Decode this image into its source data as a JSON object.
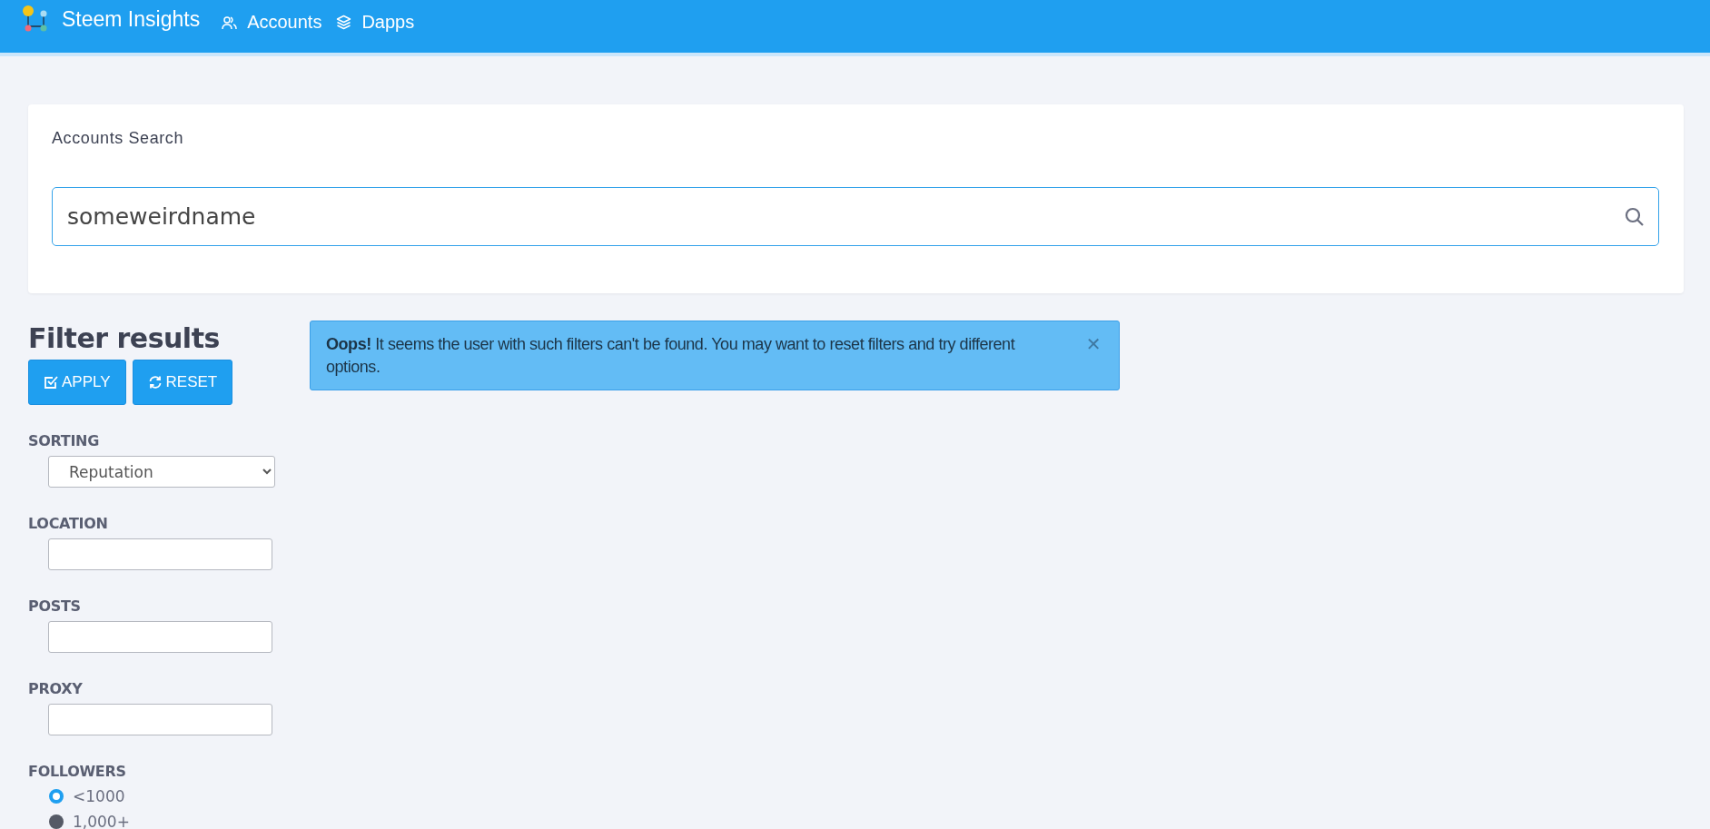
{
  "navbar": {
    "brand": "Steem Insights",
    "links": [
      {
        "label": "Accounts"
      },
      {
        "label": "Dapps"
      }
    ]
  },
  "search": {
    "title": "Accounts Search",
    "value": "someweirdname"
  },
  "filters": {
    "title": "Filter results",
    "buttons": [
      {
        "label": "APPLY"
      },
      {
        "label": "RESET"
      }
    ],
    "fields": [
      {
        "kind": "select",
        "label": "SORTING",
        "value": "Reputation"
      },
      {
        "kind": "text",
        "label": "LOCATION"
      },
      {
        "kind": "text",
        "label": "POSTS"
      },
      {
        "kind": "text",
        "label": "PROXY"
      },
      {
        "kind": "radio",
        "label": "FOLLOWERS",
        "options": [
          {
            "label": "<1000",
            "selected": true
          },
          {
            "label": "1,000+",
            "selected": false
          }
        ]
      }
    ]
  },
  "alert": {
    "message": "**Oops!** It seems the user with such filters can't be found. You may want to reset filters and try different options.",
    "close": "✕"
  }
}
